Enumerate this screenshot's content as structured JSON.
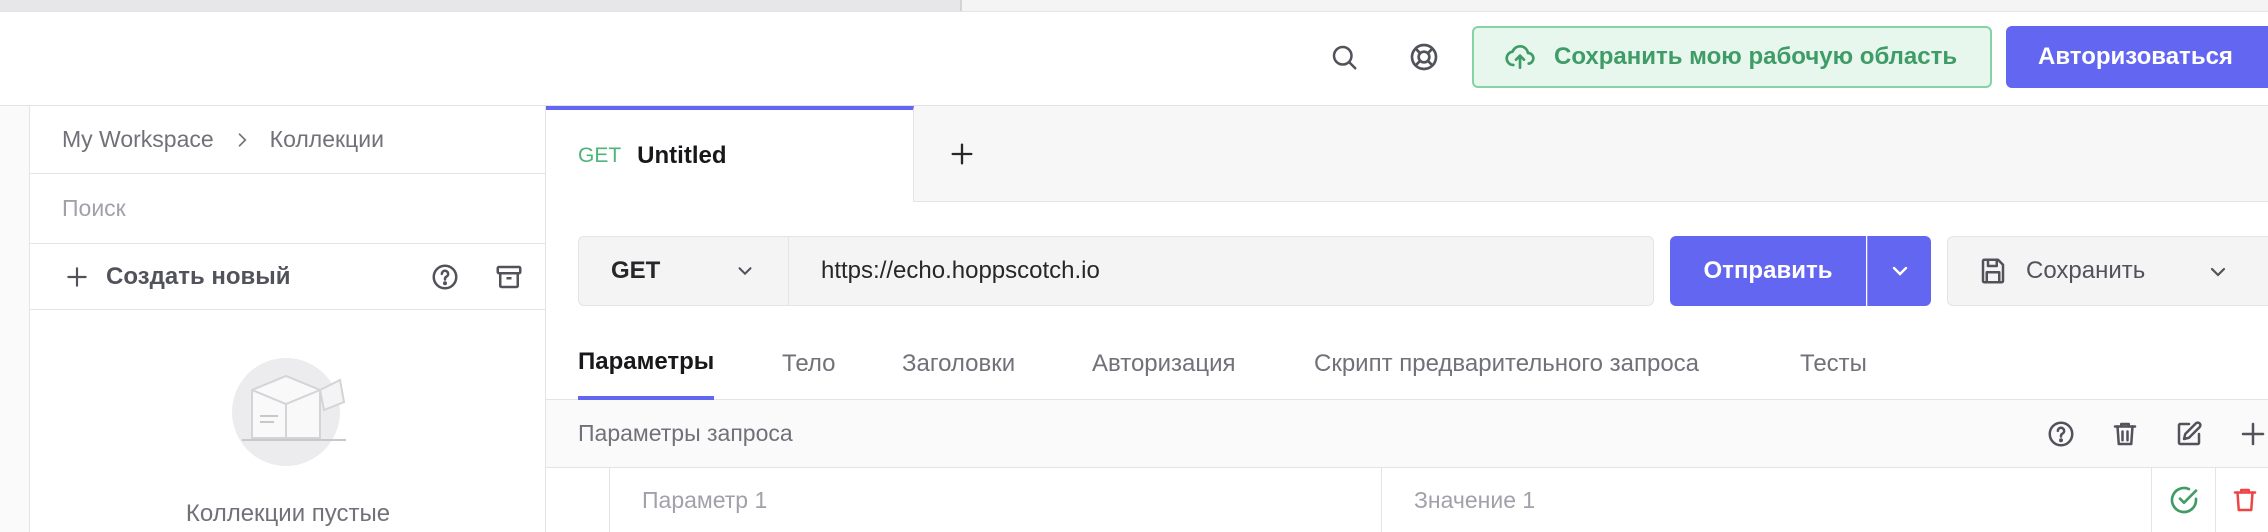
{
  "header": {
    "save_workspace_label": "Сохранить мою рабочую область",
    "login_label": "Авторизоваться"
  },
  "sidebar": {
    "breadcrumb": {
      "workspace": "My Workspace",
      "collections": "Коллекции"
    },
    "search_placeholder": "Поиск",
    "create_new_label": "Создать новый",
    "empty_text": "Коллекции пустые"
  },
  "tabs": [
    {
      "method": "GET",
      "title": "Untitled"
    }
  ],
  "request": {
    "method": "GET",
    "url": "https://echo.hoppscotch.io",
    "send_label": "Отправить",
    "save_label": "Сохранить"
  },
  "sub_tabs": [
    "Параметры",
    "Тело",
    "Заголовки",
    "Авторизация",
    "Скрипт предварительного запроса",
    "Тесты"
  ],
  "params": {
    "title": "Параметры запроса",
    "row": {
      "key_placeholder": "Параметр 1",
      "value_placeholder": "Значение 1"
    }
  },
  "colors": {
    "accent": "#6366f1",
    "success": "#3f9c66",
    "danger": "#ef4444",
    "method_get": "#4fb37a"
  }
}
